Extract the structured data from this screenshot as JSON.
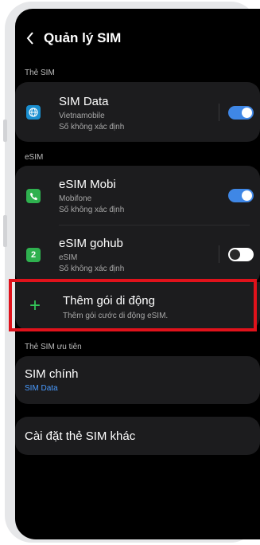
{
  "header": {
    "title": "Quản lý SIM"
  },
  "sections": {
    "physical": "Thẻ SIM",
    "esim": "eSIM",
    "priority": "Thẻ SIM ưu tiên"
  },
  "physical_sims": [
    {
      "name": "SIM Data",
      "carrier": "Vietnamobile",
      "number": "Số không xác định",
      "icon": "globe-icon",
      "icon_color": "#1a8fd0",
      "enabled": true
    }
  ],
  "esims": [
    {
      "name": "eSIM Mobi",
      "carrier": "Mobifone",
      "number": "Số không xác định",
      "icon": "phone-icon",
      "icon_color": "#2fb14f",
      "enabled": true
    },
    {
      "name": "eSIM gohub",
      "carrier": "eSIM",
      "number": "Số không xác định",
      "icon": "sim-2-icon",
      "icon_badge": "2",
      "icon_color": "#2fb14f",
      "enabled": false
    }
  ],
  "add_plan": {
    "title": "Thêm gói di động",
    "subtitle": "Thêm gói cước di động eSIM."
  },
  "primary_sim": {
    "title": "SIM chính",
    "value": "SIM Data"
  },
  "other_settings": {
    "label": "Cài đặt thẻ SIM khác"
  },
  "colors": {
    "accent": "#3f87e6",
    "highlight": "#e0121b",
    "add_green": "#34c759",
    "link_blue": "#4a9bff"
  }
}
